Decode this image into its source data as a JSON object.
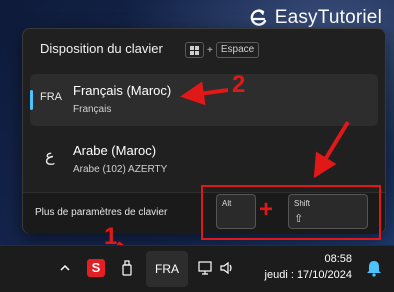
{
  "brand": {
    "name": "EasyTutoriel"
  },
  "flyout": {
    "title": "Disposition du clavier",
    "shortcut_plus": "+",
    "shortcut_key": "Espace",
    "languages": [
      {
        "code": "FRA",
        "name": "Français (Maroc)",
        "layout": "Français",
        "selected": true
      },
      {
        "code": "ع",
        "name": "Arabe (Maroc)",
        "layout": "Arabe (102) AZERTY",
        "selected": false
      }
    ],
    "more_settings": "Plus de paramètres de clavier"
  },
  "keys": {
    "alt": "Alt",
    "plus": "+",
    "shift": "Shift",
    "shift_symbol": "⇧"
  },
  "annotations": {
    "step1": "1",
    "step2": "2"
  },
  "taskbar": {
    "app_letter": "S",
    "input_indicator": "FRA",
    "time": "08:58",
    "date": "jeudi : 17/10/2024"
  },
  "colors": {
    "accent": "#4cc2ff",
    "annotation": "#e01818"
  }
}
